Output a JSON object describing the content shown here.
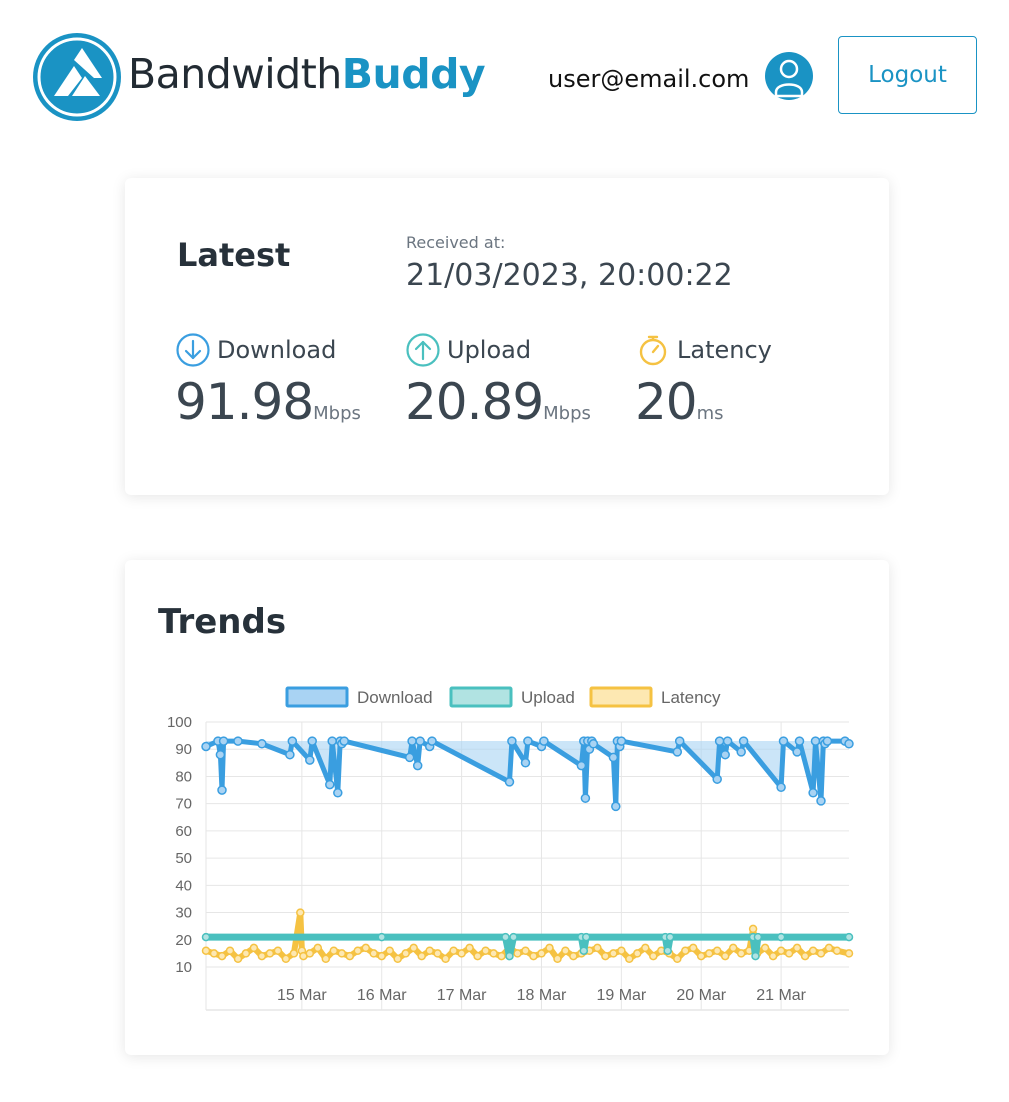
{
  "brand": {
    "name_part1": "Bandwidth",
    "name_part2": "Buddy",
    "primary_color": "#1a93c4"
  },
  "user": {
    "email": "user@email.com",
    "avatar_icon": "user-avatar-icon"
  },
  "header": {
    "logout_label": "Logout"
  },
  "latest": {
    "title": "Latest",
    "received_label": "Received at:",
    "received_value": "21/03/2023, 20:00:22",
    "metrics": [
      {
        "label": "Download",
        "value": "91.98",
        "unit": "Mbps",
        "icon": "arrow-down-circle-icon",
        "color": "#3a9ee0"
      },
      {
        "label": "Upload",
        "value": "20.89",
        "unit": "Mbps",
        "icon": "arrow-up-circle-icon",
        "color": "#4ac0bf"
      },
      {
        "label": "Latency",
        "value": "20",
        "unit": "ms",
        "icon": "stopwatch-icon",
        "color": "#f5c242"
      }
    ]
  },
  "trends": {
    "title": "Trends"
  },
  "chart_data": {
    "type": "line",
    "title": "",
    "xlabel": "",
    "ylabel": "",
    "ylim": [
      10,
      100
    ],
    "yticks": [
      100,
      90,
      80,
      70,
      60,
      50,
      40,
      30,
      20,
      10
    ],
    "xtick_labels": [
      "15 Mar",
      "16 Mar",
      "17 Mar",
      "18 Mar",
      "19 Mar",
      "20 Mar",
      "21 Mar"
    ],
    "xrange_days": [
      13.8,
      21.85
    ],
    "grid": true,
    "legend_position": "top-center",
    "series": [
      {
        "name": "Download",
        "color": "#3a9ee0",
        "fill": "#a9d3f3",
        "baseline": 93,
        "x": [
          13.8,
          13.95,
          13.98,
          14.0,
          14.02,
          14.2,
          14.5,
          14.85,
          14.88,
          15.1,
          15.13,
          15.35,
          15.38,
          15.45,
          15.48,
          15.5,
          15.53,
          16.35,
          16.38,
          16.45,
          16.48,
          16.6,
          16.63,
          17.6,
          17.63,
          17.8,
          17.83,
          18.0,
          18.03,
          18.5,
          18.53,
          18.55,
          18.58,
          18.6,
          18.63,
          18.65,
          18.9,
          18.93,
          18.95,
          18.98,
          19.0,
          19.7,
          19.73,
          20.2,
          20.23,
          20.3,
          20.33,
          20.5,
          20.53,
          21.0,
          21.03,
          21.2,
          21.23,
          21.4,
          21.43,
          21.5,
          21.53,
          21.55,
          21.58,
          21.8,
          21.85
        ],
        "y": [
          91,
          93,
          88,
          75,
          93,
          93,
          92,
          88,
          93,
          86,
          93,
          77,
          93,
          74,
          93,
          92,
          93,
          87,
          93,
          84,
          93,
          91,
          93,
          78,
          93,
          85,
          93,
          91,
          93,
          84,
          93,
          72,
          93,
          90,
          93,
          92,
          87,
          69,
          93,
          91,
          93,
          89,
          93,
          79,
          93,
          88,
          93,
          89,
          93,
          76,
          93,
          89,
          93,
          74,
          93,
          71,
          93,
          92,
          93,
          93,
          92
        ]
      },
      {
        "name": "Upload",
        "color": "#4ac0bf",
        "fill": "#b1e3e2",
        "x": [
          13.8,
          16.0,
          17.55,
          17.6,
          17.65,
          18.5,
          18.53,
          18.56,
          19.55,
          19.58,
          19.61,
          20.65,
          20.68,
          20.71,
          21.0,
          21.85
        ],
        "y": [
          21,
          21,
          21,
          14,
          21,
          21,
          16,
          21,
          21,
          16,
          21,
          21,
          14,
          21,
          21,
          21
        ]
      },
      {
        "name": "Latency",
        "color": "#f5c242",
        "fill": "#fde8b2",
        "x": [
          13.8,
          13.9,
          14.0,
          14.1,
          14.2,
          14.3,
          14.4,
          14.5,
          14.6,
          14.7,
          14.8,
          14.9,
          14.98,
          15.0,
          15.02,
          15.1,
          15.2,
          15.3,
          15.4,
          15.5,
          15.6,
          15.7,
          15.8,
          15.9,
          16.0,
          16.1,
          16.2,
          16.3,
          16.4,
          16.5,
          16.6,
          16.7,
          16.8,
          16.9,
          17.0,
          17.1,
          17.2,
          17.3,
          17.4,
          17.5,
          17.6,
          17.7,
          17.8,
          17.9,
          18.0,
          18.1,
          18.2,
          18.3,
          18.4,
          18.5,
          18.6,
          18.7,
          18.8,
          18.9,
          19.0,
          19.1,
          19.2,
          19.3,
          19.4,
          19.5,
          19.6,
          19.7,
          19.8,
          19.9,
          20.0,
          20.1,
          20.2,
          20.3,
          20.4,
          20.5,
          20.6,
          20.65,
          20.7,
          20.8,
          20.9,
          21.0,
          21.1,
          21.2,
          21.3,
          21.4,
          21.5,
          21.6,
          21.7,
          21.85
        ],
        "y": [
          16,
          15,
          14,
          16,
          13,
          15,
          17,
          14,
          15,
          16,
          13,
          15,
          30,
          16,
          14,
          15,
          17,
          13,
          16,
          15,
          14,
          16,
          17,
          15,
          14,
          16,
          13,
          15,
          17,
          14,
          16,
          15,
          13,
          16,
          15,
          17,
          14,
          16,
          15,
          14,
          17,
          15,
          16,
          14,
          15,
          17,
          13,
          16,
          14,
          15,
          16,
          17,
          14,
          15,
          16,
          13,
          15,
          17,
          14,
          16,
          15,
          13,
          16,
          17,
          14,
          15,
          16,
          14,
          17,
          15,
          16,
          24,
          15,
          17,
          14,
          16,
          15,
          17,
          14,
          16,
          15,
          17,
          16,
          15
        ]
      }
    ]
  }
}
